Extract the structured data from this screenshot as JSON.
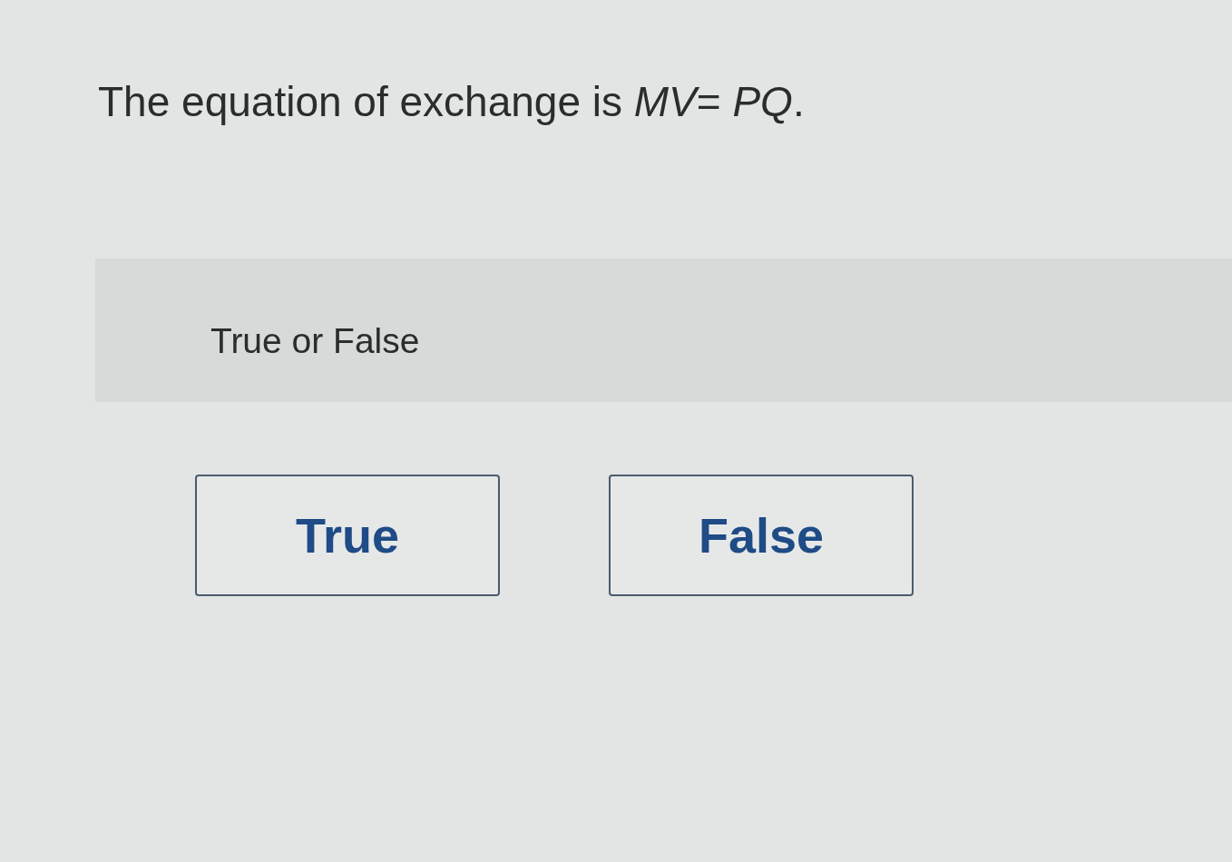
{
  "question": "The equation of exchange is *MV*= *PQ*.",
  "prompt": "True or False",
  "options": [
    "True",
    "False"
  ]
}
